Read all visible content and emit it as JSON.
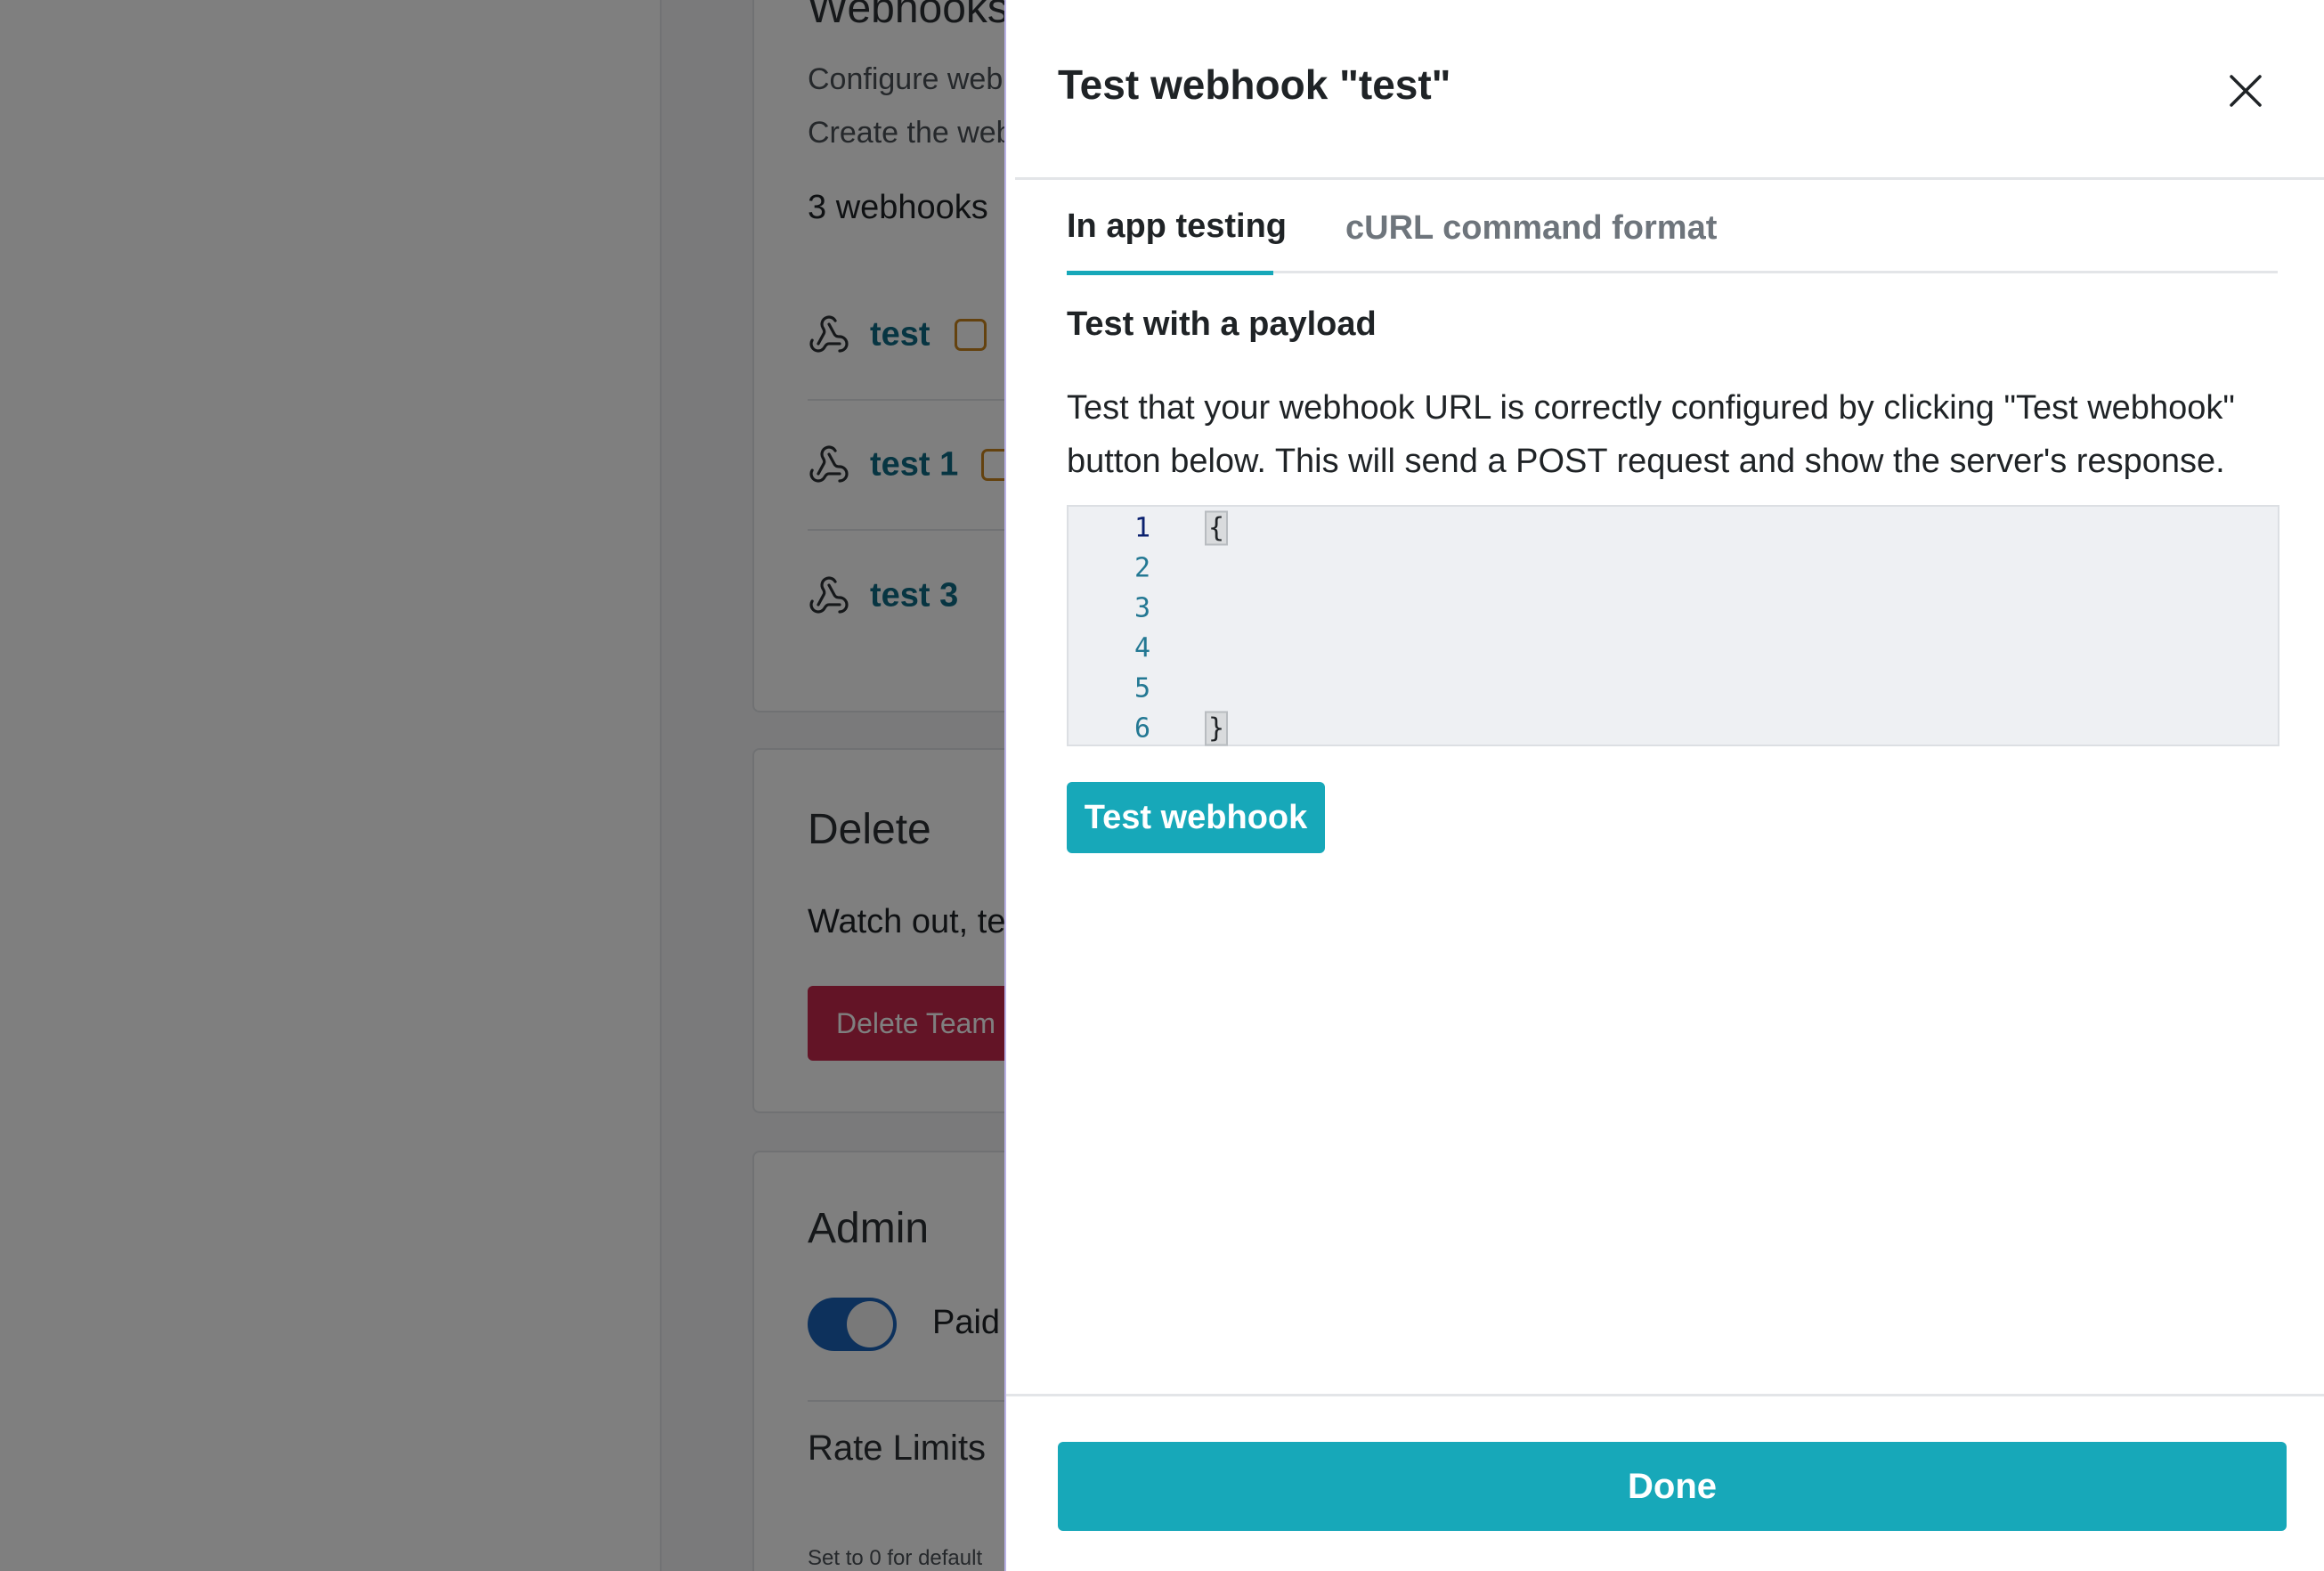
{
  "background": {
    "webhooks_card": {
      "heading": "Webhooks",
      "desc_line1": "Configure webh",
      "desc_line2": "Create the webh",
      "count_label": "3 webhooks",
      "items": [
        {
          "name": "test",
          "has_key": true
        },
        {
          "name": "test 1",
          "has_key": true
        },
        {
          "name": "test 3",
          "has_key": false
        }
      ]
    },
    "delete_card": {
      "heading": "Delete",
      "warning": "Watch out, te",
      "button_label": "Delete Team"
    },
    "admin_card": {
      "heading": "Admin",
      "paid_label": "Paid",
      "paid_enabled": true,
      "rate_limits_label": "Rate Limits",
      "rate_limits_hint": "Set to 0 for default"
    }
  },
  "modal": {
    "title": "Test webhook \"test\"",
    "tabs": [
      {
        "label": "In app testing",
        "active": true
      },
      {
        "label": "cURL command format",
        "active": false
      }
    ],
    "section_title": "Test with a payload",
    "description": "Test that your webhook URL is correctly configured by clicking \"Test webhook\" button below. This will send a POST request and show the server's response.",
    "editor": {
      "lines": [
        {
          "num": "1",
          "text": "{"
        },
        {
          "num": "2",
          "text": ""
        },
        {
          "num": "3",
          "text": ""
        },
        {
          "num": "4",
          "text": ""
        },
        {
          "num": "5",
          "text": ""
        },
        {
          "num": "6",
          "text": "}"
        }
      ]
    },
    "test_button_label": "Test webhook",
    "done_button_label": "Done"
  },
  "colors": {
    "accent": "#17a8b9",
    "link": "#0f6b85",
    "danger": "#c6294d",
    "toggle_on": "#1a63b8",
    "key_badge": "#c8851f"
  }
}
